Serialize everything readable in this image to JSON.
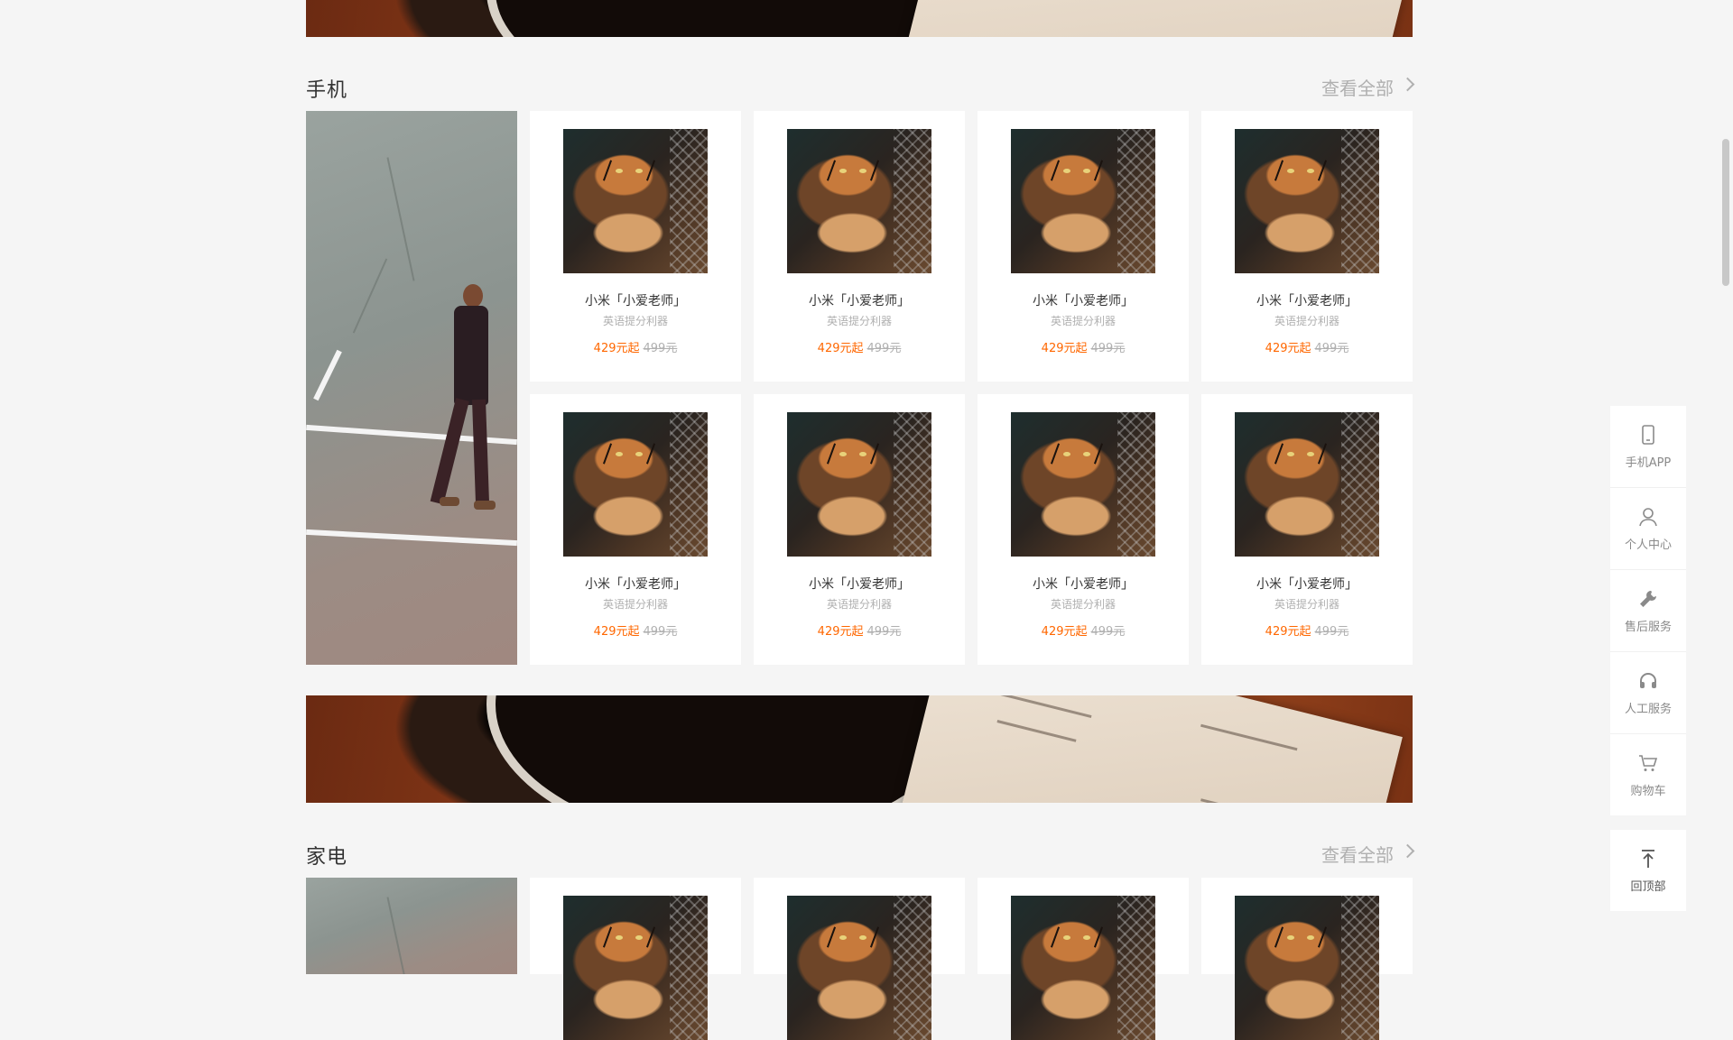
{
  "sections": [
    {
      "title": "手机",
      "view_all": "查看全部"
    },
    {
      "title": "家电",
      "view_all": "查看全部"
    }
  ],
  "product": {
    "name": "小米「小爱老师」",
    "desc": "英语提分利器",
    "price": "429元起",
    "old_price": "499元"
  },
  "sidebar": {
    "items": [
      {
        "label": "手机APP",
        "icon": "phone-icon"
      },
      {
        "label": "个人中心",
        "icon": "user-icon"
      },
      {
        "label": "售后服务",
        "icon": "wrench-icon"
      },
      {
        "label": "人工服务",
        "icon": "headset-icon"
      },
      {
        "label": "购物车",
        "icon": "cart-icon"
      }
    ],
    "back_to_top": "回顶部"
  },
  "colors": {
    "accent": "#ff6700",
    "muted": "#b0b0b0",
    "background": "#f5f5f5"
  }
}
